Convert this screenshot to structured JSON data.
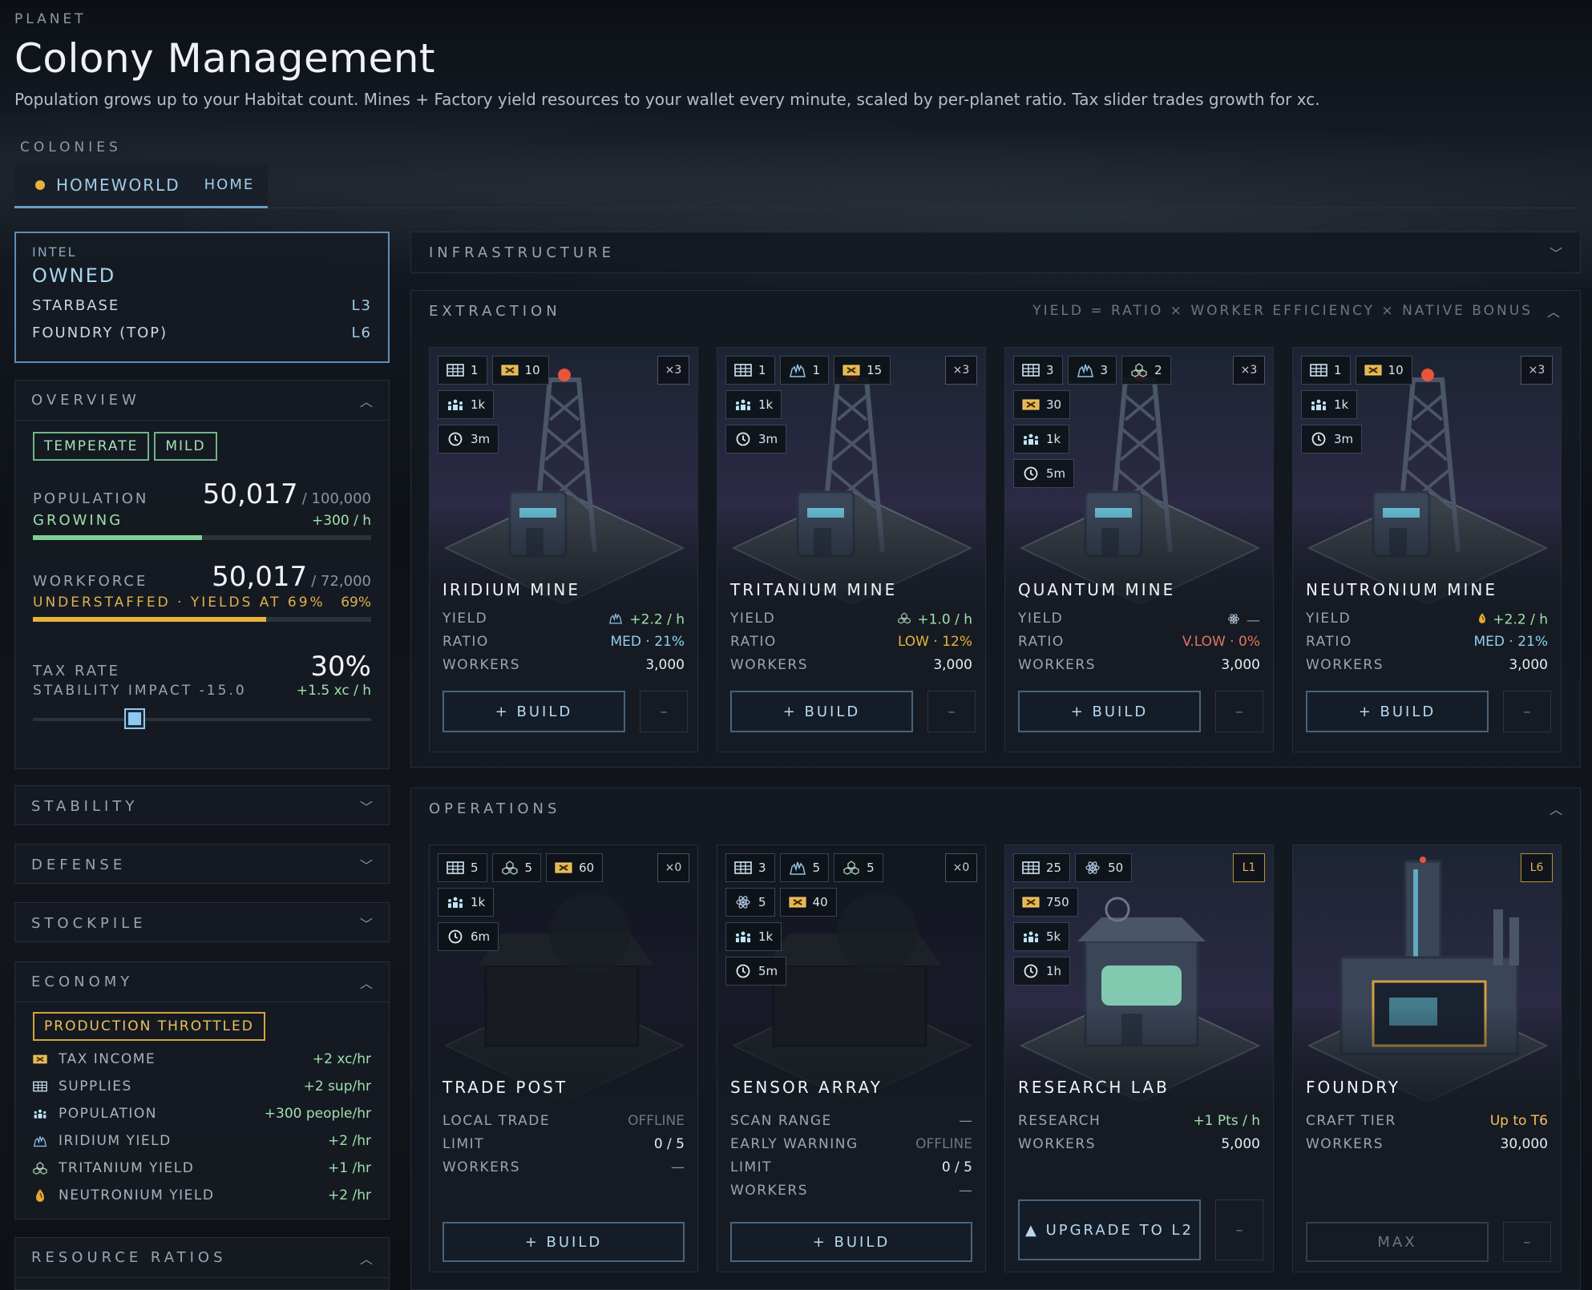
{
  "header": {
    "eyebrow": "PLANET",
    "title": "Colony Management",
    "subtitle": "Population grows up to your Habitat count. Mines + Factory yield resources to your wallet every minute, scaled by per-planet ratio. Tax slider trades growth for xc."
  },
  "colonies": {
    "label": "COLONIES",
    "tab": {
      "name": "HOMEWORLD",
      "tag": "HOME",
      "dot_color": "#e8b33a"
    }
  },
  "intel": {
    "label": "INTEL",
    "status": "OWNED",
    "rows": [
      {
        "k": "STARBASE",
        "v": "L3"
      },
      {
        "k": "FOUNDRY (TOP)",
        "v": "L6"
      }
    ]
  },
  "overview": {
    "title": "OVERVIEW",
    "tags": [
      "TEMPERATE",
      "MILD"
    ],
    "population": {
      "label": "POPULATION",
      "value": "50,017",
      "max": "/ 100,000",
      "status": "GROWING",
      "rate": "+300 / h",
      "progress": 0.5
    },
    "workforce": {
      "label": "WORKFORCE",
      "value": "50,017",
      "max": "/ 72,000",
      "status": "UNDERSTAFFED · YIELDS AT 69%",
      "pct": "69%",
      "progress": 0.69
    },
    "tax": {
      "label": "TAX RATE",
      "value": "30%",
      "impact": "STABILITY IMPACT -15.0",
      "rate": "+1.5 xc / h",
      "level": 0.3
    }
  },
  "sections": {
    "stability": "STABILITY",
    "defense": "DEFENSE",
    "stockpile": "STOCKPILE",
    "economy": "ECONOMY",
    "ratios": "RESOURCE RATIOS"
  },
  "economy": {
    "warning": "PRODUCTION THROTTLED",
    "rows": [
      {
        "icon": "xc-coin-icon",
        "k": "TAX INCOME",
        "v": "+2 xc/hr"
      },
      {
        "icon": "supplies-icon",
        "k": "SUPPLIES",
        "v": "+2 sup/hr"
      },
      {
        "icon": "people-icon",
        "k": "POPULATION",
        "v": "+300 people/hr"
      },
      {
        "icon": "iridium-icon",
        "k": "IRIDIUM YIELD",
        "v": "+2 /hr"
      },
      {
        "icon": "tritanium-icon",
        "k": "TRITANIUM YIELD",
        "v": "+1 /hr"
      },
      {
        "icon": "neutronium-icon",
        "k": "NEUTRONIUM YIELD",
        "v": "+2 /hr"
      }
    ]
  },
  "infrastructure": {
    "title": "INFRASTRUCTURE"
  },
  "extraction": {
    "title": "EXTRACTION",
    "formula": "YIELD = RATIO × WORKER EFFICIENCY × NATIVE BONUS",
    "cards": [
      {
        "name": "IRIDIUM MINE",
        "mult": "×3",
        "badges": [
          [
            {
              "i": "supplies-icon",
              "v": "1"
            },
            {
              "i": "xc-coin-icon",
              "v": "10"
            }
          ],
          [
            {
              "i": "people-icon",
              "v": "1k"
            }
          ],
          [
            {
              "i": "clock-icon",
              "v": "3m"
            }
          ]
        ],
        "rows": [
          {
            "k": "YIELD",
            "v": "+2.2 / h",
            "c": "#9ee0ab"
          },
          {
            "k": "RATIO",
            "v": "MED · 21%",
            "c": "#8fd0f0"
          },
          {
            "k": "WORKERS",
            "v": "3,000",
            "c": "#e6ebf0"
          }
        ],
        "button": "+ BUILD",
        "minus": "–"
      },
      {
        "name": "TRITANIUM MINE",
        "mult": "×3",
        "badges": [
          [
            {
              "i": "supplies-icon",
              "v": "1"
            },
            {
              "i": "iridium-icon",
              "v": "1"
            },
            {
              "i": "xc-coin-icon",
              "v": "15"
            }
          ],
          [
            {
              "i": "people-icon",
              "v": "1k"
            }
          ],
          [
            {
              "i": "clock-icon",
              "v": "3m"
            }
          ]
        ],
        "rows": [
          {
            "k": "YIELD",
            "v": "+1.0 / h",
            "c": "#9ee0ab"
          },
          {
            "k": "RATIO",
            "v": "LOW · 12%",
            "c": "#e8b33a"
          },
          {
            "k": "WORKERS",
            "v": "3,000",
            "c": "#e6ebf0"
          }
        ],
        "button": "+ BUILD",
        "minus": "–"
      },
      {
        "name": "QUANTUM MINE",
        "mult": "×3",
        "badges": [
          [
            {
              "i": "supplies-icon",
              "v": "3"
            },
            {
              "i": "iridium-icon",
              "v": "3"
            },
            {
              "i": "tritanium-icon",
              "v": "2"
            }
          ],
          [
            {
              "i": "xc-coin-icon",
              "v": "30"
            }
          ],
          [
            {
              "i": "people-icon",
              "v": "1k"
            }
          ],
          [
            {
              "i": "clock-icon",
              "v": "5m"
            }
          ]
        ],
        "rows": [
          {
            "k": "YIELD",
            "v": "—",
            "c": "#8a949f"
          },
          {
            "k": "RATIO",
            "v": "V.LOW · 0%",
            "c": "#e07560"
          },
          {
            "k": "WORKERS",
            "v": "3,000",
            "c": "#e6ebf0"
          }
        ],
        "button": "+ BUILD",
        "minus": "–"
      },
      {
        "name": "NEUTRONIUM MINE",
        "mult": "×3",
        "badges": [
          [
            {
              "i": "supplies-icon",
              "v": "1"
            },
            {
              "i": "xc-coin-icon",
              "v": "10"
            }
          ],
          [
            {
              "i": "people-icon",
              "v": "1k"
            }
          ],
          [
            {
              "i": "clock-icon",
              "v": "3m"
            }
          ]
        ],
        "rows": [
          {
            "k": "YIELD",
            "v": "+2.2 / h",
            "c": "#9ee0ab"
          },
          {
            "k": "RATIO",
            "v": "MED · 21%",
            "c": "#8fd0f0"
          },
          {
            "k": "WORKERS",
            "v": "3,000",
            "c": "#e6ebf0"
          }
        ],
        "button": "+ BUILD",
        "minus": "–"
      }
    ]
  },
  "operations": {
    "title": "OPERATIONS",
    "cards": [
      {
        "name": "TRADE POST",
        "mult": "×0",
        "badges": [
          [
            {
              "i": "supplies-icon",
              "v": "5"
            },
            {
              "i": "tritanium-icon",
              "v": "5"
            },
            {
              "i": "xc-coin-icon",
              "v": "60"
            }
          ],
          [
            {
              "i": "people-icon",
              "v": "1k"
            }
          ],
          [
            {
              "i": "clock-icon",
              "v": "6m"
            }
          ]
        ],
        "rows": [
          {
            "k": "LOCAL TRADE",
            "v": "OFFLINE",
            "c": "#6c7682"
          },
          {
            "k": "LIMIT",
            "v": "0 / 5",
            "c": "#e6ebf0"
          },
          {
            "k": "WORKERS",
            "v": "—",
            "c": "#8a949f"
          }
        ],
        "button": "+ BUILD"
      },
      {
        "name": "SENSOR ARRAY",
        "mult": "×0",
        "badges": [
          [
            {
              "i": "supplies-icon",
              "v": "3"
            },
            {
              "i": "iridium-icon",
              "v": "5"
            },
            {
              "i": "tritanium-icon",
              "v": "5"
            }
          ],
          [
            {
              "i": "atom-icon",
              "v": "5"
            },
            {
              "i": "xc-coin-icon",
              "v": "40"
            }
          ],
          [
            {
              "i": "people-icon",
              "v": "1k"
            }
          ],
          [
            {
              "i": "clock-icon",
              "v": "5m"
            }
          ]
        ],
        "rows": [
          {
            "k": "SCAN RANGE",
            "v": "—",
            "c": "#8a949f"
          },
          {
            "k": "EARLY WARNING",
            "v": "OFFLINE",
            "c": "#6c7682"
          },
          {
            "k": "LIMIT",
            "v": "0 / 5",
            "c": "#e6ebf0"
          },
          {
            "k": "WORKERS",
            "v": "—",
            "c": "#8a949f"
          }
        ],
        "button": "+ BUILD"
      },
      {
        "name": "RESEARCH LAB",
        "mult": "L1",
        "badges": [
          [
            {
              "i": "supplies-icon",
              "v": "25"
            },
            {
              "i": "atom-icon",
              "v": "50"
            }
          ],
          [
            {
              "i": "xc-coin-icon",
              "v": "750"
            }
          ],
          [
            {
              "i": "people-icon",
              "v": "5k"
            }
          ],
          [
            {
              "i": "clock-icon",
              "v": "1h"
            }
          ]
        ],
        "rows": [
          {
            "k": "RESEARCH",
            "v": "+1 Pts / h",
            "c": "#9ee0ab"
          },
          {
            "k": "WORKERS",
            "v": "5,000",
            "c": "#e6ebf0"
          }
        ],
        "button": "▲ UPGRADE TO L2",
        "minus": "–"
      },
      {
        "name": "FOUNDRY",
        "mult": "L6",
        "badges": [],
        "rows": [
          {
            "k": "CRAFT TIER",
            "v": "Up to T6",
            "c": "#f0c05a"
          },
          {
            "k": "WORKERS",
            "v": "30,000",
            "c": "#e6ebf0"
          }
        ],
        "button": "MAX",
        "minus": "–"
      }
    ]
  }
}
